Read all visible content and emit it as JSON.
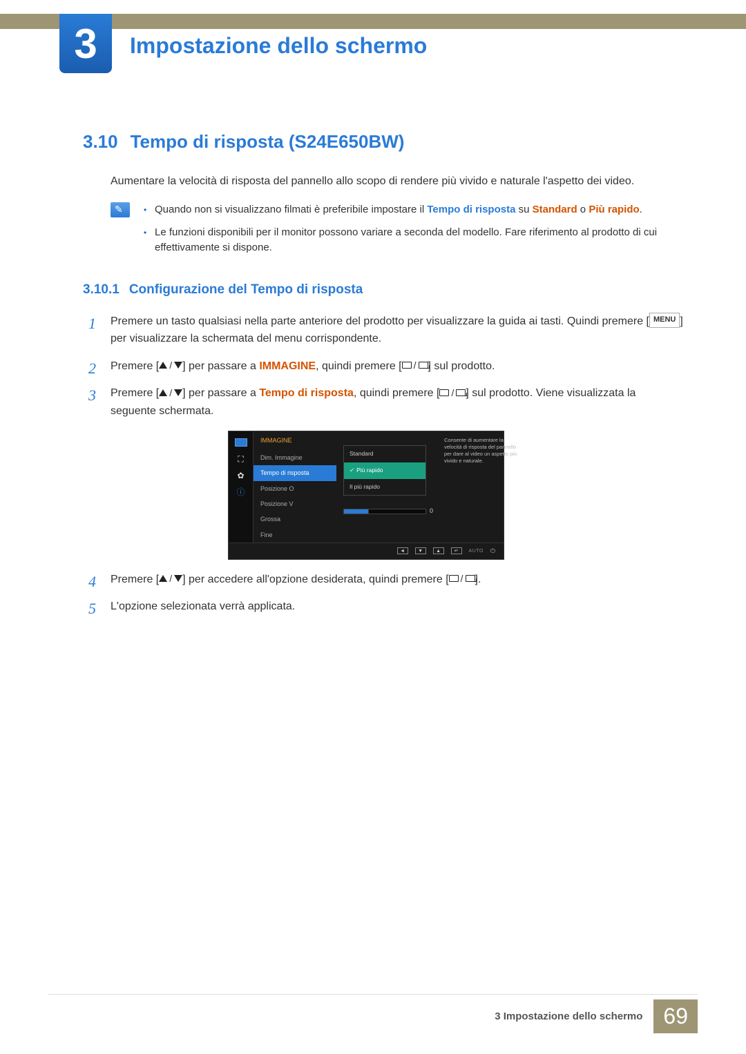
{
  "chapter": {
    "number": "3",
    "title": "Impostazione dello schermo"
  },
  "section": {
    "number": "3.10",
    "title": "Tempo di risposta (S24E650BW)"
  },
  "intro": "Aumentare la velocità di risposta del pannello allo scopo di rendere più vivido e naturale l'aspetto dei video.",
  "note": {
    "items": [
      {
        "pre": "Quando non si visualizzano filmati è preferibile impostare il ",
        "b1": "Tempo di risposta",
        "mid": " su ",
        "b2": "Standard",
        "mid2": " o ",
        "b3": "Più rapido",
        "post": "."
      },
      {
        "text": "Le funzioni disponibili per il monitor possono variare a seconda del modello. Fare riferimento al prodotto di cui effettivamente si dispone."
      }
    ]
  },
  "subsection": {
    "number": "3.10.1",
    "title": "Configurazione del Tempo di risposta"
  },
  "steps": {
    "s1a": "Premere un tasto qualsiasi nella parte anteriore del prodotto per visualizzare la guida ai tasti. Quindi premere [",
    "s1_menu": "MENU",
    "s1b": "] per visualizzare la schermata del menu corrispondente.",
    "s2a": "Premere [",
    "s2b": "] per passare a ",
    "s2_kw": "IMMAGINE",
    "s2c": ", quindi premere [",
    "s2d": "] sul prodotto.",
    "s3a": "Premere [",
    "s3b": "] per passare a ",
    "s3_kw": "Tempo di risposta",
    "s3c": ", quindi premere [",
    "s3d": "] sul prodotto. Viene visualizzata la seguente schermata.",
    "s4a": "Premere [",
    "s4b": "] per accedere all'opzione desiderata, quindi premere [",
    "s4c": "].",
    "s5": "L'opzione selezionata verrà applicata."
  },
  "osd": {
    "header": "IMMAGINE",
    "menu": [
      "Dim. Immagine",
      "Tempo di risposta",
      "Posizione O",
      "Posizione V",
      "Grossa",
      "Fine"
    ],
    "selectedIndex": 1,
    "submenu": [
      "Standard",
      "Più rapido",
      "Il più rapido"
    ],
    "submenuSelected": 1,
    "sliderValue": "0",
    "tooltip": "Consente di aumentare la velocità di risposta del pannello per dare al video un aspetto più vivido e naturale.",
    "footer": {
      "auto": "AUTO"
    }
  },
  "footer": {
    "text": "3 Impostazione dello schermo",
    "page": "69"
  }
}
